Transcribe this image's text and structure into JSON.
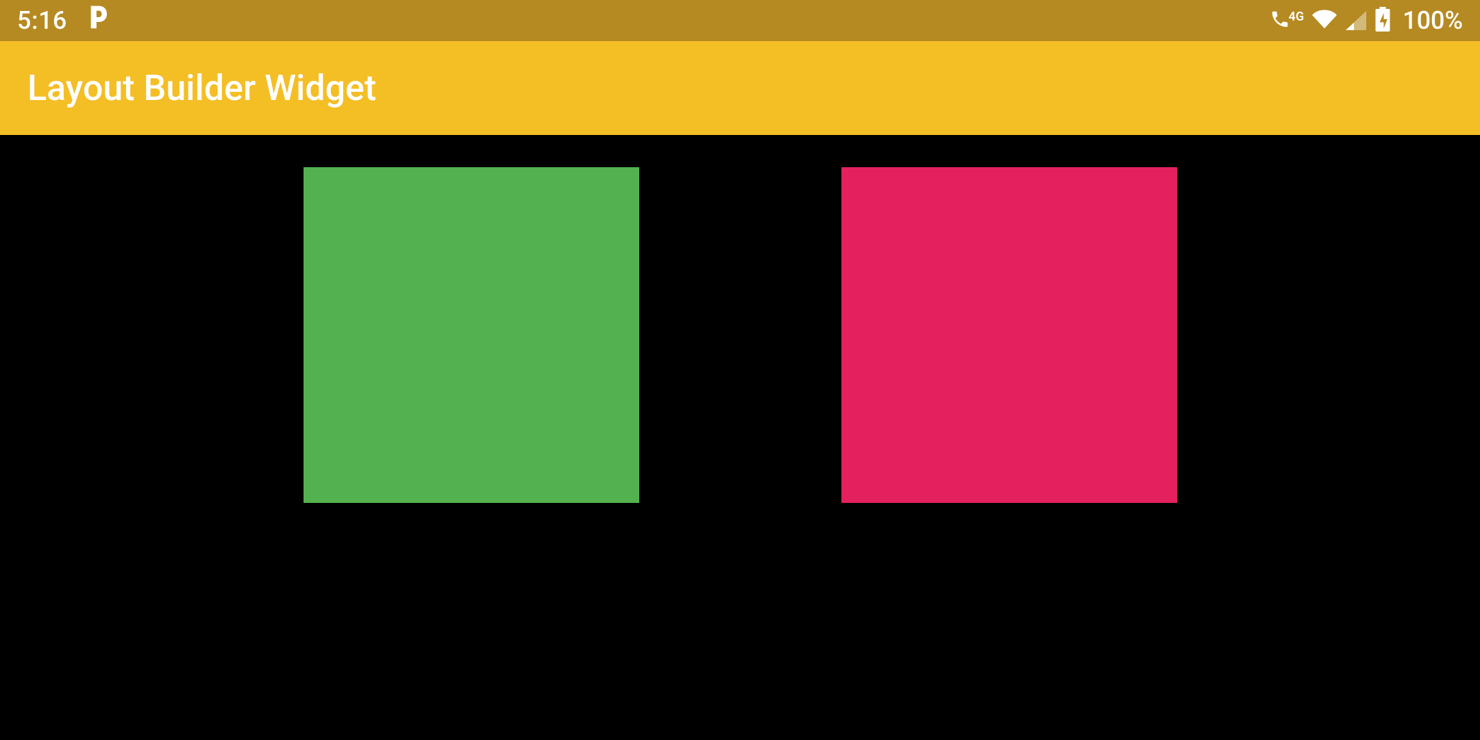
{
  "status_bar": {
    "time": "5:16",
    "network_label": "4G",
    "battery_percent": "100%",
    "icons": {
      "p": "p-icon",
      "phone": "phone-icon",
      "wifi": "wifi-icon",
      "signal": "signal-icon",
      "battery": "battery-charging-icon"
    }
  },
  "app_bar": {
    "title": "Layout Builder Widget"
  },
  "content": {
    "boxes": [
      {
        "name": "green-box",
        "color": "#54b150"
      },
      {
        "name": "pink-box",
        "color": "#e4215e"
      }
    ]
  },
  "colors": {
    "status_bar_bg": "#b68a22",
    "app_bar_bg": "#f4be25",
    "content_bg": "#000000",
    "box_green": "#54b150",
    "box_pink": "#e4215e",
    "text_white": "#ffffff"
  }
}
